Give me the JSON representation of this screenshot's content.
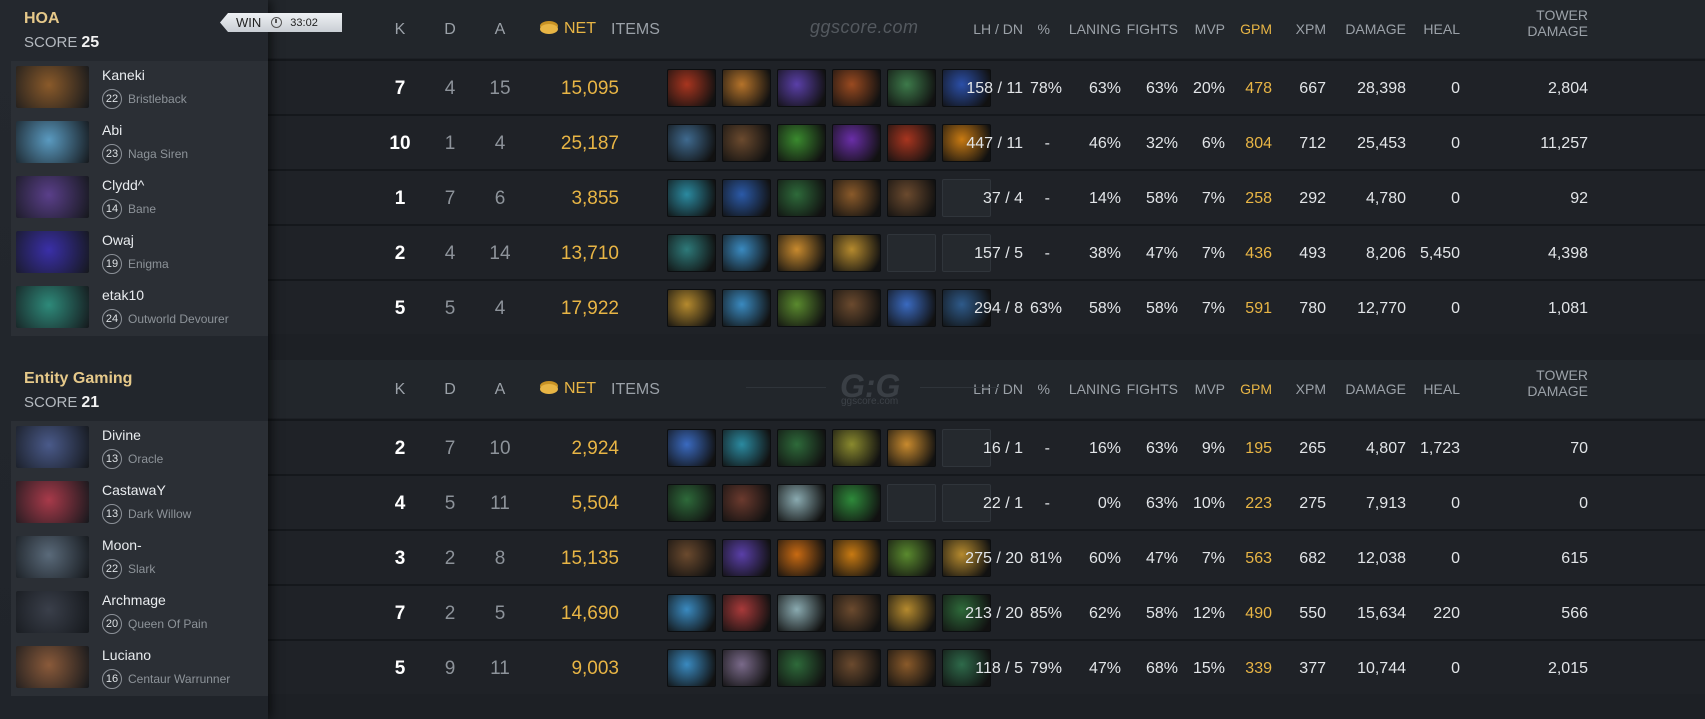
{
  "teams": [
    {
      "name": "HOA",
      "score_label": "SCORE",
      "score": "25",
      "result": "WIN",
      "duration": "33:02",
      "watermark": "ggscore.com",
      "players": [
        {
          "name": "Kaneki",
          "level": "22",
          "hero": "Bristleback",
          "k": "7",
          "d": "4",
          "a": "15",
          "net": "15,095",
          "lh_dn": "158 / 11",
          "pct": "78%",
          "laning": "63%",
          "fights": "63%",
          "mvp": "20%",
          "gpm": "478",
          "xpm": "667",
          "damage": "28,398",
          "heal": "0",
          "tower": "2,804",
          "portrait": "#8a5a2a",
          "items": [
            "#a8351f",
            "#b5732a",
            "#5a3fa8",
            "#9a4a20",
            "#3d7a4a",
            "#2b4fa8"
          ]
        },
        {
          "name": "Abi",
          "level": "23",
          "hero": "Naga Siren",
          "k": "10",
          "d": "1",
          "a": "4",
          "net": "25,187",
          "lh_dn": "447 / 11",
          "pct": "-",
          "laning": "46%",
          "fights": "32%",
          "mvp": "6%",
          "gpm": "804",
          "xpm": "712",
          "damage": "25,453",
          "heal": "0",
          "tower": "11,257",
          "portrait": "#5a9ac0",
          "items": [
            "#3f6a8f",
            "#6b4a2e",
            "#3a8a2e",
            "#6a2ea8",
            "#a8351f",
            "#c87a12"
          ]
        },
        {
          "name": "Clydd^",
          "level": "14",
          "hero": "Bane",
          "k": "1",
          "d": "7",
          "a": "6",
          "net": "3,855",
          "lh_dn": "37 / 4",
          "pct": "-",
          "laning": "14%",
          "fights": "58%",
          "mvp": "7%",
          "gpm": "258",
          "xpm": "292",
          "damage": "4,780",
          "heal": "0",
          "tower": "92",
          "portrait": "#5a3f8a",
          "items": [
            "#2b8aa0",
            "#2b5aa8",
            "#2e6a3a",
            "#8a5a2a",
            "#6b4a2e",
            ""
          ]
        },
        {
          "name": "Owaj",
          "level": "19",
          "hero": "Enigma",
          "k": "2",
          "d": "4",
          "a": "14",
          "net": "13,710",
          "lh_dn": "157 / 5",
          "pct": "-",
          "laning": "38%",
          "fights": "47%",
          "mvp": "7%",
          "gpm": "436",
          "xpm": "493",
          "damage": "8,206",
          "heal": "5,450",
          "tower": "4,398",
          "portrait": "#3a2fa8",
          "items": [
            "#2e7a7a",
            "#3a8ac0",
            "#c88a2e",
            "#b58a2e",
            "",
            ""
          ]
        },
        {
          "name": "etak10",
          "level": "24",
          "hero": "Outworld Devourer",
          "k": "5",
          "d": "5",
          "a": "4",
          "net": "17,922",
          "lh_dn": "294 / 8",
          "pct": "63%",
          "laning": "58%",
          "fights": "58%",
          "mvp": "7%",
          "gpm": "591",
          "xpm": "780",
          "damage": "12,770",
          "heal": "0",
          "tower": "1,081",
          "portrait": "#2e8a7a",
          "items": [
            "#b58a2e",
            "#3a8ac0",
            "#5a8a2e",
            "#6b4a2e",
            "#3a6ac0",
            "#2e5a8a"
          ]
        }
      ]
    },
    {
      "name": "Entity Gaming",
      "score_label": "SCORE",
      "score": "21",
      "watermark_big": "G:G",
      "watermark_small": "ggscore.com",
      "players": [
        {
          "name": "Divine",
          "level": "13",
          "hero": "Oracle",
          "k": "2",
          "d": "7",
          "a": "10",
          "net": "2,924",
          "lh_dn": "16 / 1",
          "pct": "-",
          "laning": "16%",
          "fights": "63%",
          "mvp": "9%",
          "gpm": "195",
          "xpm": "265",
          "damage": "4,807",
          "heal": "1,723",
          "tower": "70",
          "portrait": "#4a5a8a",
          "items": [
            "#3a6ac0",
            "#2b8aa0",
            "#2e6a3a",
            "#8a8a2e",
            "#c88a2e",
            ""
          ]
        },
        {
          "name": "CastawaY",
          "level": "13",
          "hero": "Dark Willow",
          "k": "4",
          "d": "5",
          "a": "11",
          "net": "5,504",
          "lh_dn": "22 / 1",
          "pct": "-",
          "laning": "0%",
          "fights": "63%",
          "mvp": "10%",
          "gpm": "223",
          "xpm": "275",
          "damage": "7,913",
          "heal": "0",
          "tower": "0",
          "portrait": "#a83a4a",
          "items": [
            "#2e6a3a",
            "#6b3a2e",
            "#8aaab0",
            "#2e8a3a",
            "",
            ""
          ]
        },
        {
          "name": "Moon-",
          "level": "22",
          "hero": "Slark",
          "k": "3",
          "d": "2",
          "a": "8",
          "net": "15,135",
          "lh_dn": "275 / 20",
          "pct": "81%",
          "laning": "60%",
          "fights": "47%",
          "mvp": "7%",
          "gpm": "563",
          "xpm": "682",
          "damage": "12,038",
          "heal": "0",
          "tower": "615",
          "portrait": "#5a6a7a",
          "items": [
            "#6b4a2e",
            "#5a3fa8",
            "#c86a12",
            "#c87a12",
            "#5a8a2e",
            "#b58a2e"
          ]
        },
        {
          "name": "Archmage",
          "level": "20",
          "hero": "Queen Of Pain",
          "k": "7",
          "d": "2",
          "a": "5",
          "net": "14,690",
          "lh_dn": "213 / 20",
          "pct": "85%",
          "laning": "62%",
          "fights": "58%",
          "mvp": "12%",
          "gpm": "490",
          "xpm": "550",
          "damage": "15,634",
          "heal": "220",
          "tower": "566",
          "portrait": "#3a3f4a",
          "items": [
            "#3a8ac0",
            "#a83a3a",
            "#8aaab0",
            "#6b4a2e",
            "#b58a2e",
            "#2e6a3a"
          ]
        },
        {
          "name": "Luciano",
          "level": "16",
          "hero": "Centaur Warrunner",
          "k": "5",
          "d": "9",
          "a": "11",
          "net": "9,003",
          "lh_dn": "118 / 5",
          "pct": "79%",
          "laning": "47%",
          "fights": "68%",
          "mvp": "15%",
          "gpm": "339",
          "xpm": "377",
          "damage": "10,744",
          "heal": "0",
          "tower": "2,015",
          "portrait": "#8a5a3a",
          "items": [
            "#3a8ac0",
            "#7a6a8a",
            "#2e6a3a",
            "#6b4a2e",
            "#8a5a2a",
            "#2e6a4a"
          ]
        }
      ]
    }
  ],
  "columns": {
    "k": "K",
    "d": "D",
    "a": "A",
    "net": "NET",
    "items": "ITEMS",
    "lh_dn": "LH  /  DN",
    "pct": "%",
    "laning": "LANING",
    "fights": "FIGHTS",
    "mvp": "MVP",
    "gpm": "GPM",
    "xpm": "XPM",
    "damage": "DAMAGE",
    "heal": "HEAL",
    "tower_1": "TOWER",
    "tower_2": "DAMAGE"
  },
  "colors": {
    "gold": "#e8b545",
    "team_name": "#e6c98a",
    "bg": "#1d2025"
  },
  "icons": [
    "gold-coins-icon",
    "clock-icon"
  ]
}
